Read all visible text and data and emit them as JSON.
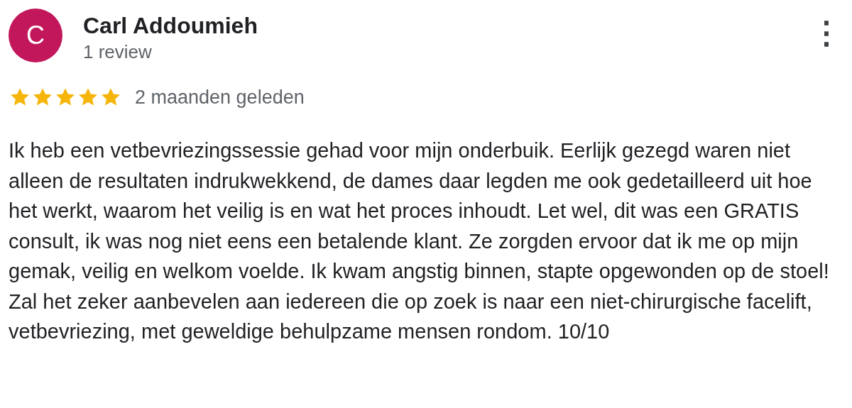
{
  "review": {
    "avatar": {
      "letter": "C",
      "color": "#c2185b"
    },
    "author": "Carl Addoumieh",
    "author_meta": "1 review",
    "menu_icon": "⋮",
    "stars": 5,
    "time": "2 maanden geleden",
    "text": "Ik heb een vetbevriezingssessie gehad voor mijn onderbuik. Eerlijk gezegd waren niet alleen de resultaten indrukwekkend, de dames daar legden me ook gedetailleerd uit hoe het werkt, waarom het veilig is en wat het proces inhoudt. Let wel, dit was een GRATIS consult, ik was nog niet eens een betalende klant. Ze zorgden ervoor dat ik me op mijn gemak, veilig en welkom voelde. Ik kwam angstig binnen, stapte opgewonden op de stoel! Zal het zeker aanbevelen aan iedereen die op zoek is naar een niet-chirurgische facelift, vetbevriezing, met geweldige behulpzame mensen rondom. 10/10"
  }
}
